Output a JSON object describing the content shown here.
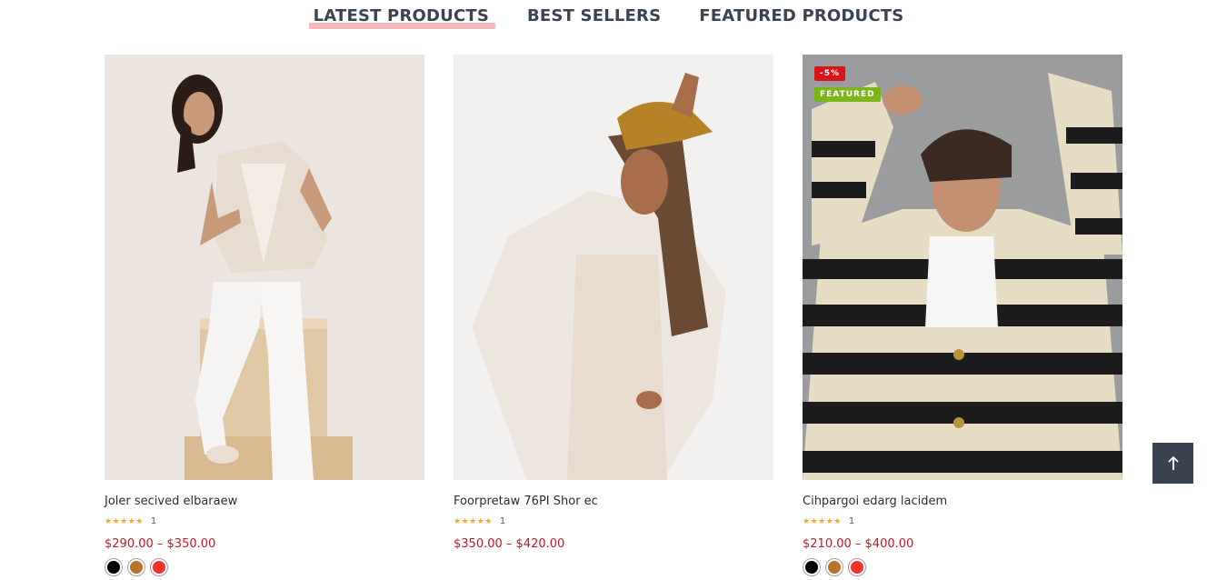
{
  "tabs": [
    {
      "label": "LATEST PRODUCTS",
      "active": true
    },
    {
      "label": "BEST SELLERS",
      "active": false
    },
    {
      "label": "FEATURED PRODUCTS",
      "active": false
    }
  ],
  "products": [
    {
      "name": "Joler secived elbaraew",
      "stars": "★★★★★",
      "rating_count": "1",
      "price": "$290.00 – $350.00",
      "badges": [],
      "swatches": [
        "#000000",
        "#b8732f",
        "#f0342c"
      ]
    },
    {
      "name": "Foorpretaw 76PI Shor ec",
      "stars": "★★★★★",
      "rating_count": "1",
      "price": "$350.00 – $420.00",
      "badges": [],
      "swatches": []
    },
    {
      "name": "Cihpargoi edarg lacidem",
      "stars": "★★★★★",
      "rating_count": "1",
      "price": "$210.00 – $400.00",
      "badges": [
        "-5%",
        "FEATURED"
      ],
      "swatches": [
        "#000000",
        "#b8732f",
        "#f0342c"
      ]
    }
  ],
  "back_to_top": {
    "icon": "arrow-up-icon",
    "glyph": "🡑"
  },
  "colors": {
    "accent": "#c0191f",
    "tab_underline": "#f2b8bd",
    "sale": "#d8131a",
    "featured": "#7cb518",
    "dark": "#3a4451",
    "star": "#f5a623"
  }
}
